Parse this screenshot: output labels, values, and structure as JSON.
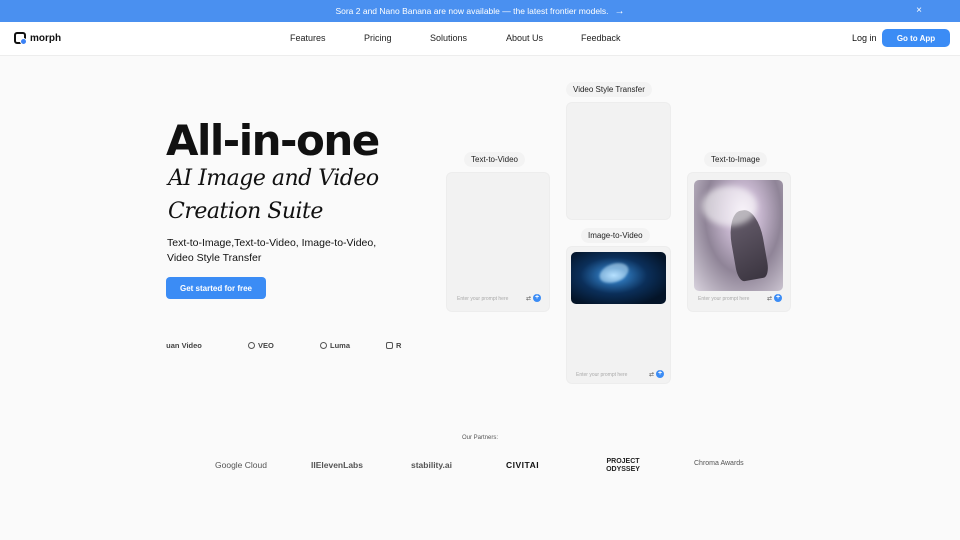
{
  "banner": {
    "text": "Sora 2 and Nano Banana are now available — the latest frontier models.",
    "arrow": "→",
    "close": "×"
  },
  "nav": {
    "logo_text": "morph",
    "links": [
      "Features",
      "Pricing",
      "Solutions",
      "About Us",
      "Feedback"
    ],
    "login": "Log in",
    "go_to_app": "Go to App"
  },
  "hero": {
    "title": "All-in-one",
    "script_line1": "AI Image and Video",
    "script_line2": "Creation Suite",
    "subtitle": "Text-to-Image,Text-to-Video, Image-to-Video, Video Style Transfer",
    "cta": "Get started for free",
    "models": [
      "yuan Video",
      "VEO",
      "Luma",
      "R"
    ]
  },
  "cards": {
    "text_to_video": {
      "label": "Text-to-Video",
      "placeholder": "Enter your prompt here"
    },
    "video_style_transfer": {
      "label": "Video Style Transfer"
    },
    "image_to_video": {
      "label": "Image-to-Video",
      "placeholder": "Enter your prompt here"
    },
    "text_to_image": {
      "label": "Text-to-Image",
      "placeholder": "Enter your prompt here"
    }
  },
  "partners": {
    "title": "Our Partners:",
    "logos": [
      "Google Cloud",
      "IIElevenLabs",
      "stability.ai",
      "CIVITAI",
      "PROJECT ODYSSEY",
      "Chroma Awards"
    ]
  },
  "colors": {
    "accent": "#3b8cf5",
    "banner": "#4a90f0"
  }
}
